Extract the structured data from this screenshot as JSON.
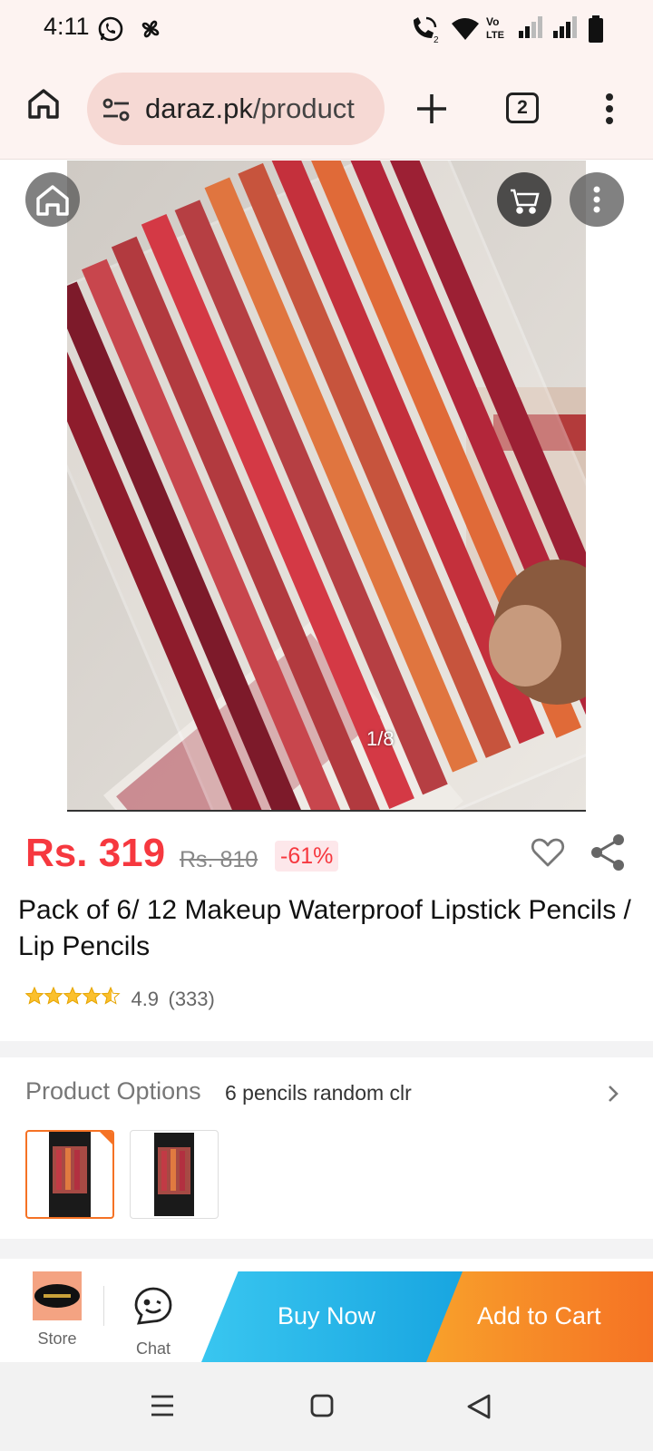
{
  "status_bar": {
    "time": "4:11"
  },
  "browser": {
    "url_host": "daraz.pk",
    "url_path": "/product",
    "tab_count": "2"
  },
  "gallery": {
    "counter": "1/8"
  },
  "product": {
    "price": "Rs. 319",
    "original_price": "Rs. 810",
    "discount": "-61%",
    "title": "Pack of 6/ 12 Makeup Waterproof Lipstick Pencils / Lip Pencils",
    "rating": "4.9",
    "rating_count": "(333)",
    "stars": 4.9
  },
  "options": {
    "label": "Product Options",
    "value": "6 pencils random clr"
  },
  "action_bar": {
    "store_label": "Store",
    "chat_label": "Chat",
    "buy_now_label": "Buy Now",
    "add_to_cart_label": "Add to Cart"
  },
  "colors": {
    "price_red": "#f6383f",
    "accent_orange": "#f57224",
    "buy_now_blue": "#18a5e0",
    "star_yellow": "#fbc02d",
    "browser_bar": "#fdf3f1"
  }
}
